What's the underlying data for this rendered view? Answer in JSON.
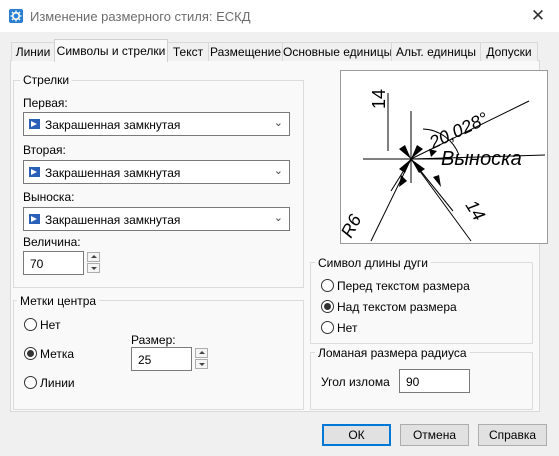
{
  "window": {
    "title": "Изменение размерного стиля: ЕСКД",
    "close_glyph": "✕"
  },
  "tabs": [
    {
      "label": "Линии"
    },
    {
      "label": "Символы и стрелки"
    },
    {
      "label": "Текст"
    },
    {
      "label": "Размещение"
    },
    {
      "label": "Основные единицы"
    },
    {
      "label": "Альт. единицы"
    },
    {
      "label": "Допуски"
    }
  ],
  "arrows": {
    "group_title": "Стрелки",
    "first_label": "Первая:",
    "first_value": "Закрашенная замкнутая",
    "second_label": "Вторая:",
    "second_value": "Закрашенная замкнутая",
    "leader_label": "Выноска:",
    "leader_value": "Закрашенная замкнутая",
    "size_label": "Величина:",
    "size_value": "70"
  },
  "center_marks": {
    "group_title": "Метки центра",
    "options": [
      {
        "label": "Нет",
        "selected": false
      },
      {
        "label": "Метка",
        "selected": true
      },
      {
        "label": "Линии",
        "selected": false
      }
    ],
    "size_label": "Размер:",
    "size_value": "25"
  },
  "preview": {
    "dim_top": "14",
    "angle": "20,028°",
    "leader_text": "Выноска",
    "radius": "R6",
    "dim_right": "14"
  },
  "arc_length": {
    "group_title": "Символ длины дуги",
    "options": [
      {
        "label": "Перед текстом размера",
        "selected": false
      },
      {
        "label": "Над текстом размера",
        "selected": true
      },
      {
        "label": "Нет",
        "selected": false
      }
    ]
  },
  "jog": {
    "group_title": "Ломаная размера радиуса",
    "angle_label": "Угол излома",
    "angle_value": "90"
  },
  "buttons": {
    "ok": "ОК",
    "cancel": "Отмена",
    "help": "Справка"
  },
  "colors": {
    "accent": "#0078d7",
    "icon_blue": "#2a60b8"
  }
}
